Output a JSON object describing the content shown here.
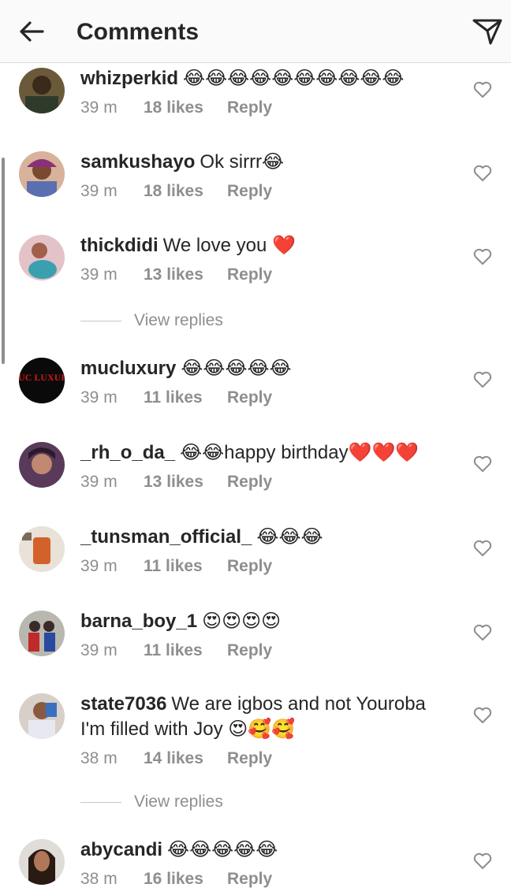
{
  "header": {
    "title": "Comments",
    "back_icon": "arrow-left-icon",
    "action_icon": "send-icon"
  },
  "colors": {
    "meta": "#8e8e8e",
    "text": "#262626",
    "heart": "#ed4956",
    "emoji": "#fcc21b"
  },
  "comments": [
    {
      "username": "whizperkid",
      "text": "😂😂😂😂😂😂😂😂😂😂",
      "time": "39 m",
      "likes": "18 likes",
      "reply": "Reply"
    },
    {
      "username": "samkushayo",
      "text": "Ok sirrr😂",
      "time": "39 m",
      "likes": "18 likes",
      "reply": "Reply"
    },
    {
      "username": "thickdidi",
      "text": "We love you ❤️",
      "time": "39 m",
      "likes": "13 likes",
      "reply": "Reply",
      "view_replies": "View replies"
    },
    {
      "username": "mucluxury",
      "text": "😂😂😂😂😂",
      "time": "39 m",
      "likes": "11 likes",
      "reply": "Reply",
      "avatar_text": "MUC LUXURY"
    },
    {
      "username": "_rh_o_da_",
      "text": "😂😂happy birthday❤️❤️❤️",
      "time": "39 m",
      "likes": "13 likes",
      "reply": "Reply"
    },
    {
      "username": "_tunsman_official_",
      "text": "😂😂😂",
      "time": "39 m",
      "likes": "11 likes",
      "reply": "Reply"
    },
    {
      "username": "barna_boy_1",
      "text": "😍😍😍😍",
      "time": "39 m",
      "likes": "11 likes",
      "reply": "Reply"
    },
    {
      "username": "state7036",
      "text": "We are igbos and not Youroba I'm filled with Joy 😍🥰🥰",
      "time": "38 m",
      "likes": "14 likes",
      "reply": "Reply",
      "view_replies": "View replies"
    },
    {
      "username": "abycandi",
      "text": "😂😂😂😂😂",
      "time": "38 m",
      "likes": "16 likes",
      "reply": "Reply"
    }
  ]
}
